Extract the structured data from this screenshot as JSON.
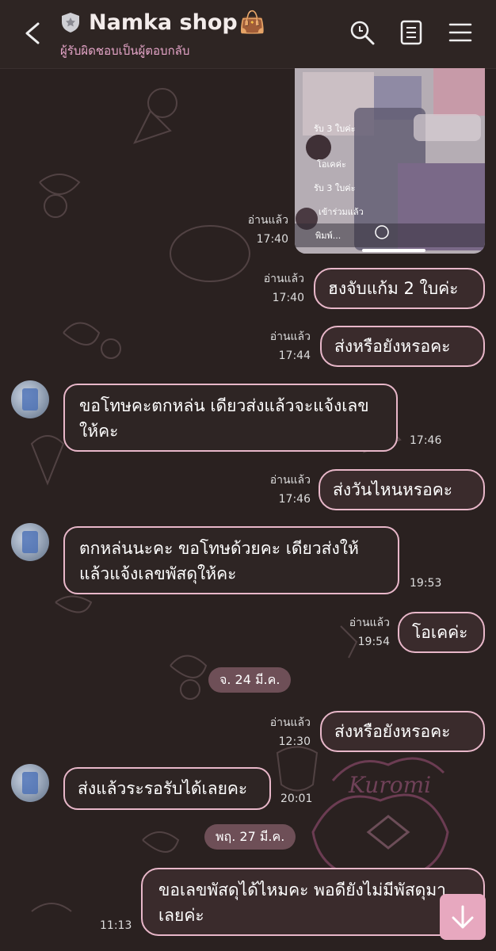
{
  "header": {
    "title": "Namka shop",
    "title_emoji": "👜",
    "subtitle": "ผู้รับผิดชอบเป็นผู้ตอบกลับ"
  },
  "messages": [
    {
      "side": "out",
      "type": "image",
      "read": "อ่านแล้ว",
      "time": "17:40"
    },
    {
      "side": "out",
      "text": "ฮงจับแก้ม 2 ใบค่ะ",
      "read": "อ่านแล้ว",
      "time": "17:40"
    },
    {
      "side": "out",
      "text": "ส่งหรือยังหรอคะ",
      "read": "อ่านแล้ว",
      "time": "17:44"
    },
    {
      "side": "in",
      "line1": "ขอโทษคะตกหล่น เดียวส่งแล้วจะแจ้งเลข",
      "line2": "ให้คะ",
      "time": "17:46"
    },
    {
      "side": "out",
      "text": "ส่งวันไหนหรอคะ",
      "read": "อ่านแล้ว",
      "time": "17:46"
    },
    {
      "side": "in",
      "line1": "ตกหล่นนะคะ ขอโทษด้วยคะ เดียวส่งให้",
      "line2": "แล้วแจ้งเลขพัสดุให้คะ",
      "time": "19:53"
    },
    {
      "side": "out",
      "text": "โอเคค่ะ",
      "read": "อ่านแล้ว",
      "time": "19:54"
    },
    {
      "side": "date",
      "text": "จ. 24 มี.ค."
    },
    {
      "side": "out",
      "text": "ส่งหรือยังหรอคะ",
      "read": "อ่านแล้ว",
      "time": "12:30"
    },
    {
      "side": "in",
      "line1": "ส่งแล้วระรอรับได้เลยคะ",
      "time": "20:01"
    },
    {
      "side": "date",
      "text": "พฤ. 27 มี.ค."
    },
    {
      "side": "out",
      "line1": "ขอเลขพัสดุได้ไหมคะ พอดียังไม่มีพัสดุมา",
      "line2": "เลยค่ะ",
      "time": "11:13"
    }
  ],
  "photo_overlay": {
    "line_a": "รับ 3 ใบค่ะ",
    "line_b": "โอเคค่ะ",
    "line_c": "รับ 3 ใบค่ะ",
    "line_d": "เข้าร่วมแล้ว",
    "line_e": "พิมพ์..."
  },
  "icons": {
    "back": "chevron-left-icon",
    "search": "search-icon",
    "notes": "notes-icon",
    "menu": "menu-icon",
    "scroll": "arrow-down-icon"
  },
  "colors": {
    "bubble_border": "#e8b7c9",
    "date_pill": "#6e4f57",
    "subtitle": "#e5a5c8",
    "scroll_button": "#e7a8bf"
  }
}
